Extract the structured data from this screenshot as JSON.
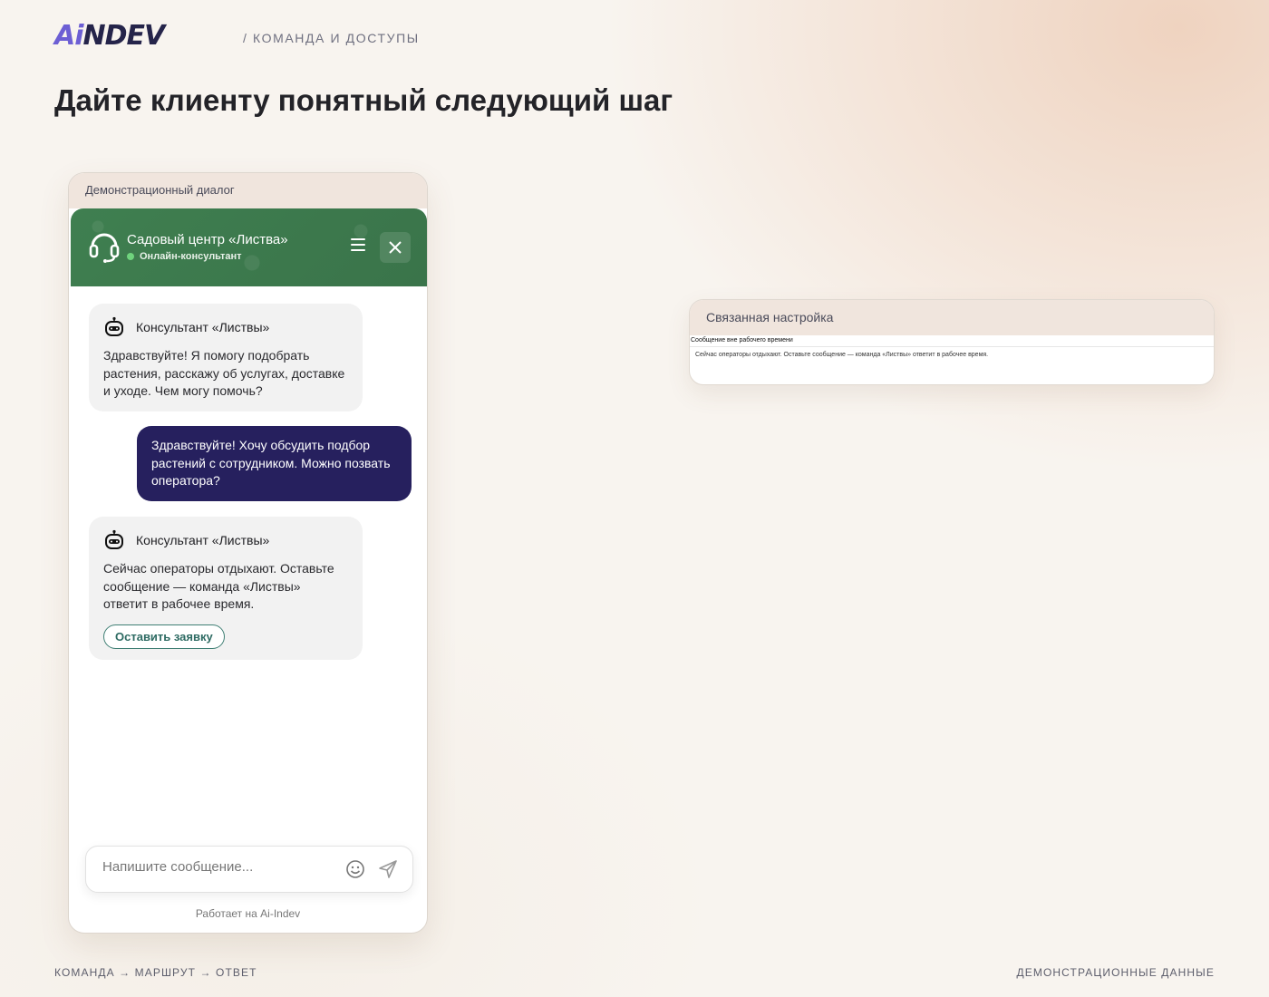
{
  "header": {
    "logo_ai": "Ai",
    "logo_rest": "NDEV",
    "breadcrumb": "/ КОМАНДА И ДОСТУПЫ",
    "title": "Дайте клиенту понятный следующий шаг"
  },
  "demo": {
    "panel_title": "Демонстрационный диалог",
    "chat": {
      "shop_name": "Садовый центр «Листва»",
      "shop_status": "Онлайн-консультант",
      "messages": [
        {
          "from": "bot",
          "name": "Консультант «Листвы»",
          "text": "Здравствуйте! Я помогу подобрать растения, расскажу об услугах, доставке и уходе. Чем могу помочь?"
        },
        {
          "from": "user",
          "text": "Здравствуйте! Хочу обсудить подбор растений с сотрудником. Можно позвать оператора?"
        },
        {
          "from": "bot",
          "name": "Консультант «Листвы»",
          "text": "Сейчас операторы отдыхают. Оставьте сообщение — команда «Листвы» ответит в рабочее время.",
          "button": "Оставить заявку"
        }
      ],
      "input_placeholder": "Напишите сообщение...",
      "powered_by": "Работает на Ai-Indev"
    }
  },
  "settings": {
    "panel_title": "Связанная настройка",
    "label": "Сообщение вне рабочего времени",
    "value": "Сейчас операторы отдыхают. Оставьте сообщение — команда «Листвы» ответит в рабочее время."
  },
  "footer": {
    "left": "КОМАНДА → МАРШРУТ → ОТВЕТ",
    "right": "ДЕМОНСТРАЦИОННЫЕ ДАННЫЕ"
  },
  "colors": {
    "chat_header": "#3e7b4e",
    "user_bubble": "#26205e",
    "accent": "#6d5fd4"
  }
}
